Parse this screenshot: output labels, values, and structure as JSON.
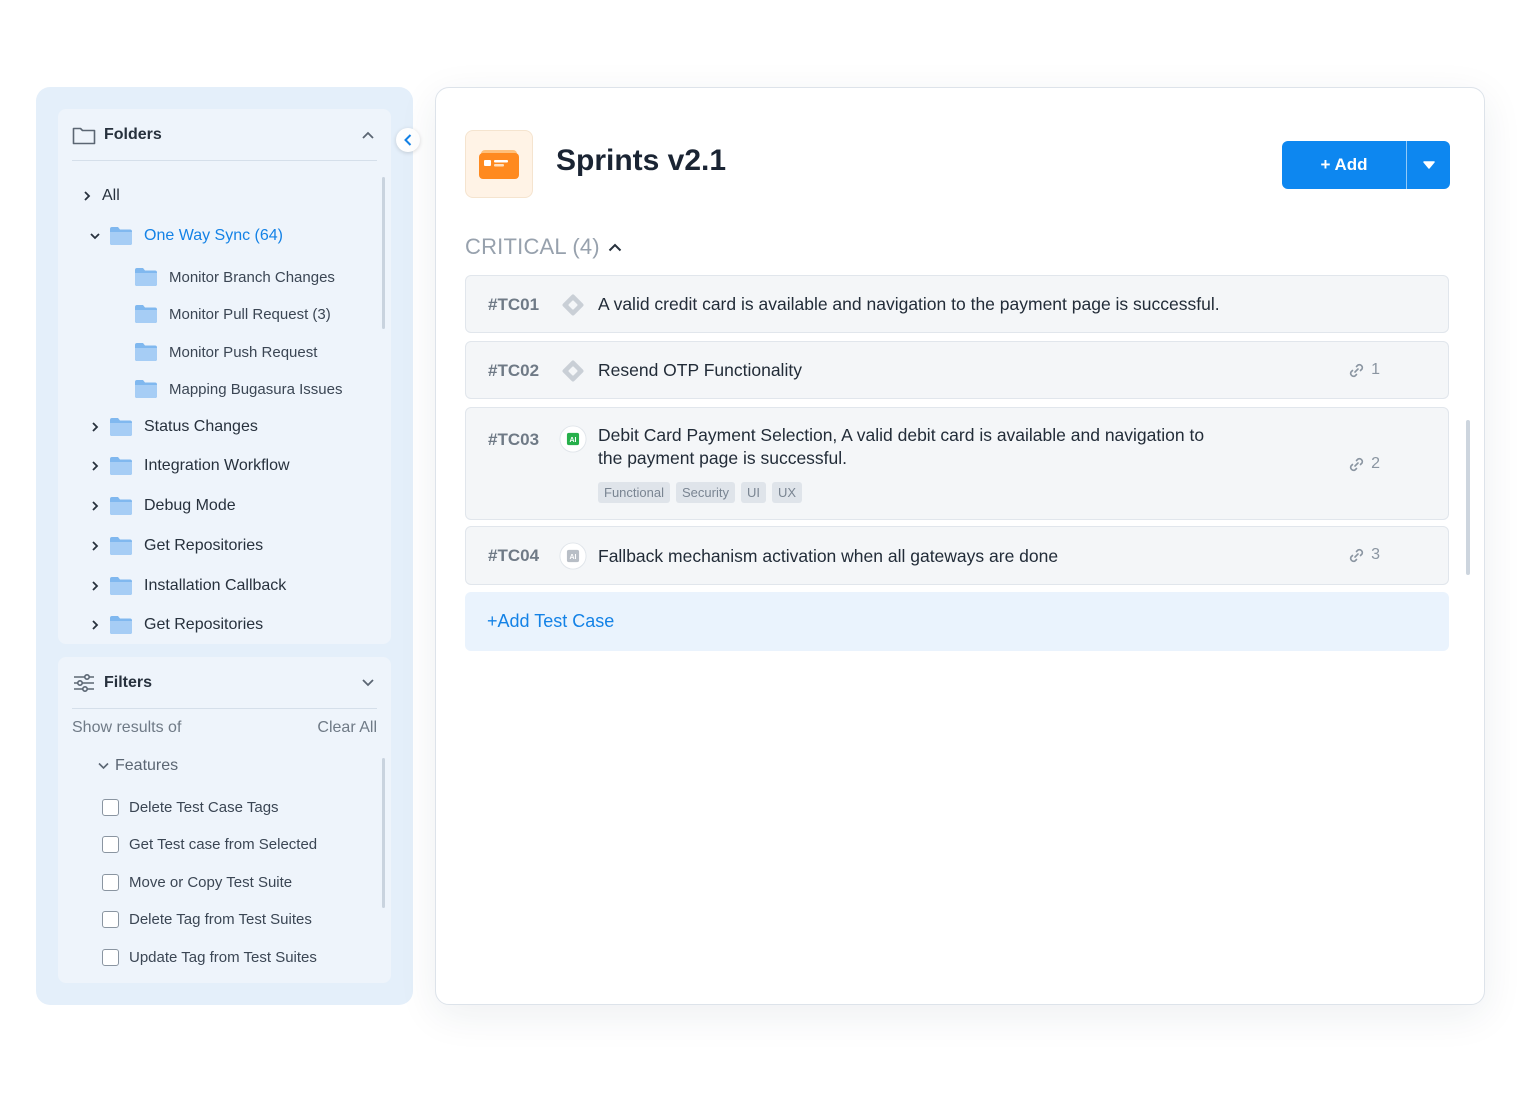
{
  "sidebar": {
    "folders": {
      "title": "Folders",
      "items": [
        {
          "label": "All",
          "level": 0,
          "expanded": false
        },
        {
          "label": "One Way Sync (64)",
          "level": 0,
          "expanded": true,
          "active": true
        },
        {
          "label": "Monitor Branch Changes",
          "level": 1
        },
        {
          "label": "Monitor Pull Request (3)",
          "level": 1
        },
        {
          "label": "Monitor Push Request",
          "level": 1
        },
        {
          "label": "Mapping Bugasura Issues",
          "level": 1
        },
        {
          "label": "Status Changes",
          "level": 0,
          "expanded": false
        },
        {
          "label": "Integration Workflow",
          "level": 0,
          "expanded": false
        },
        {
          "label": "Debug Mode",
          "level": 0,
          "expanded": false
        },
        {
          "label": "Get Repositories",
          "level": 0,
          "expanded": false
        },
        {
          "label": "Installation Callback",
          "level": 0,
          "expanded": false
        },
        {
          "label": "Get Repositories",
          "level": 0,
          "expanded": false
        }
      ]
    },
    "filters": {
      "title": "Filters",
      "show_results": "Show results of",
      "clear_all": "Clear All",
      "group": "Features",
      "options": [
        "Delete Test Case Tags",
        "Get Test case from Selected",
        "Move or Copy Test Suite",
        "Delete Tag from Test Suites",
        "Update Tag from Test Suites"
      ]
    }
  },
  "main": {
    "title": "Sprints v2.1",
    "add_label": "+ Add",
    "section": "CRITICAL (4)",
    "test_cases": [
      {
        "id": "#TC01",
        "icon": "diamond-icon",
        "text": "A valid credit card is available and navigation to the payment page is successful.",
        "links": ""
      },
      {
        "id": "#TC02",
        "icon": "diamond-icon",
        "text": "Resend OTP Functionality",
        "links": "1"
      },
      {
        "id": "#TC03",
        "icon": "ai-badge-icon",
        "text": "Debit Card Payment Selection, A valid debit card is available and navigation to",
        "text2": "the payment page is successful.",
        "links": "2",
        "tags": [
          "Functional",
          "Security",
          "UI",
          "UX"
        ]
      },
      {
        "id": "#TC04",
        "icon": "ai-badge-gray-icon",
        "text": "Fallback mechanism activation when all gateways are done",
        "links": "3"
      }
    ],
    "add_test_case": "+Add Test Case"
  },
  "colors": {
    "accent": "#0d87f0",
    "active_text": "#1482e6",
    "sidebar_bg": "#e4effa",
    "ai_green": "#27b04b",
    "orange": "#ff8a1f"
  }
}
